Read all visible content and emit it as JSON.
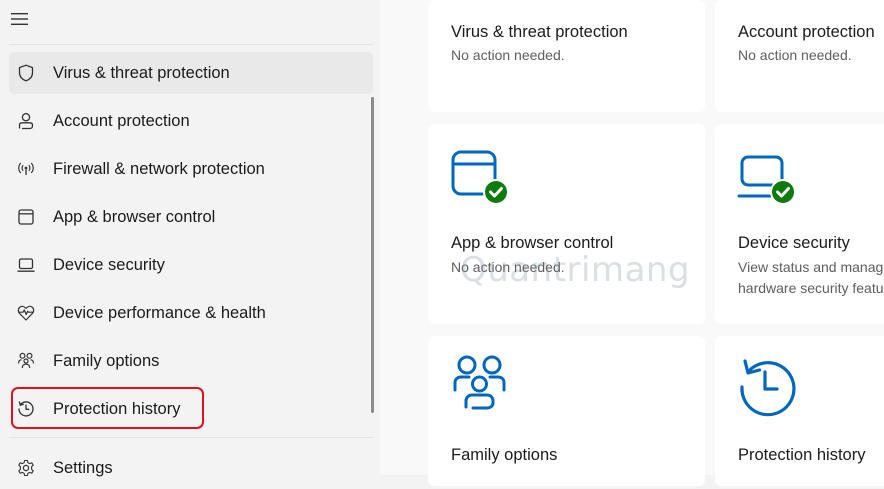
{
  "sidebar": {
    "items": [
      {
        "label": "Virus & threat protection",
        "icon": "shield-icon"
      },
      {
        "label": "Account protection",
        "icon": "person-icon"
      },
      {
        "label": "Firewall & network protection",
        "icon": "wifi-antenna-icon"
      },
      {
        "label": "App & browser control",
        "icon": "app-window-icon"
      },
      {
        "label": "Device security",
        "icon": "laptop-icon"
      },
      {
        "label": "Device performance & health",
        "icon": "heart-pulse-icon"
      },
      {
        "label": "Family options",
        "icon": "family-icon"
      },
      {
        "label": "Protection history",
        "icon": "history-icon"
      },
      {
        "label": "Settings",
        "icon": "gear-icon"
      }
    ]
  },
  "cards": {
    "virus": {
      "title": "Virus & threat protection",
      "subtitle": "No action needed."
    },
    "account": {
      "title": "Account protection",
      "subtitle": "No action needed."
    },
    "app_browser": {
      "title": "App & browser control",
      "subtitle": "No action needed."
    },
    "device_security": {
      "title": "Device security",
      "subtitle_line1": "View status and manage",
      "subtitle_line2": "hardware security features"
    },
    "family": {
      "title": "Family options"
    },
    "protection_history": {
      "title": "Protection history"
    }
  },
  "watermark": "Quantrimang",
  "colors": {
    "accent": "#0067c0",
    "check_green": "#0f7b0f",
    "highlight_red": "#e0101d"
  }
}
